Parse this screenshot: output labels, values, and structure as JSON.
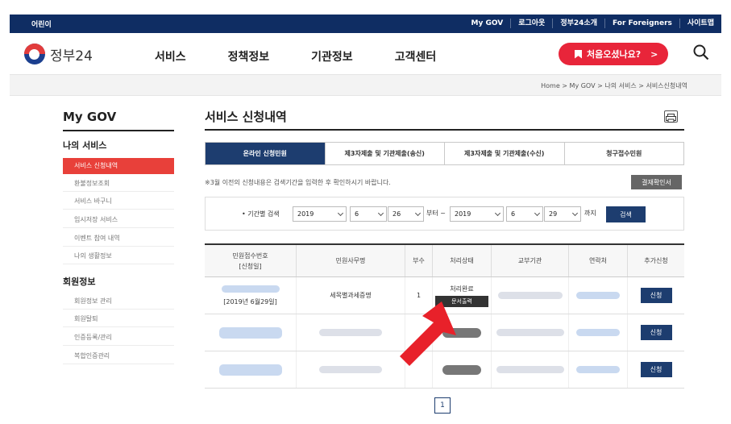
{
  "topbar": {
    "kids_label": "어린이",
    "links": [
      "My GOV",
      "로그아웃",
      "정부24소개",
      "For Foreigners",
      "사이트맵"
    ]
  },
  "header": {
    "logo_text": "정부24",
    "nav": [
      "서비스",
      "정책정보",
      "기관정보",
      "고객센터"
    ],
    "first_visit_label": "처음오셨나요?",
    "first_visit_arrow": ">"
  },
  "breadcrumb": "Home > My GOV > 나의 서비스 > 서비스신청내역",
  "sidebar": {
    "title": "My GOV",
    "section1": "나의 서비스",
    "items1": [
      "서비스 신청내역",
      "환불정보조회",
      "서비스 바구니",
      "임시저장 서비스",
      "이벤트 참여 내역",
      "나의 생활정보"
    ],
    "section2": "회원정보",
    "items2": [
      "회원정보 관리",
      "회원탈퇴",
      "인증등록/관리",
      "복합인증관리"
    ]
  },
  "main": {
    "title": "서비스 신청내역",
    "tabs": [
      "온라인 신청민원",
      "제3자제출 및 기관제출(송신)",
      "제3자제출 및 기관제출(수신)",
      "청구접수민원"
    ],
    "notice": "※3월 이전의 신청내용은 검색기간을 입력한 후 확인하시기 바랍니다.",
    "confirm_button": "결재확인서",
    "search": {
      "label": "• 기간별 검색",
      "from_year": "2019",
      "from_month": "6",
      "from_day": "26",
      "from_suffix": "부터 ~",
      "to_year": "2019",
      "to_month": "6",
      "to_day": "29",
      "to_suffix": "까지",
      "button": "검색"
    },
    "table": {
      "headers": [
        "민원접수번호\n[신청일]",
        "민원사무명",
        "부수",
        "처리상태",
        "교부기관",
        "연락처",
        "추가신청"
      ],
      "header_line1": "민원접수번호",
      "header_line2": "[신청일]",
      "row1": {
        "date": "[2019년 6월29일]",
        "name": "세목별과세증명",
        "count": "1",
        "status": "처리완료",
        "print_button": "문서출력",
        "apply_button": "신청"
      },
      "row2_apply": "신청",
      "row3_apply": "신청"
    },
    "page": "1"
  }
}
